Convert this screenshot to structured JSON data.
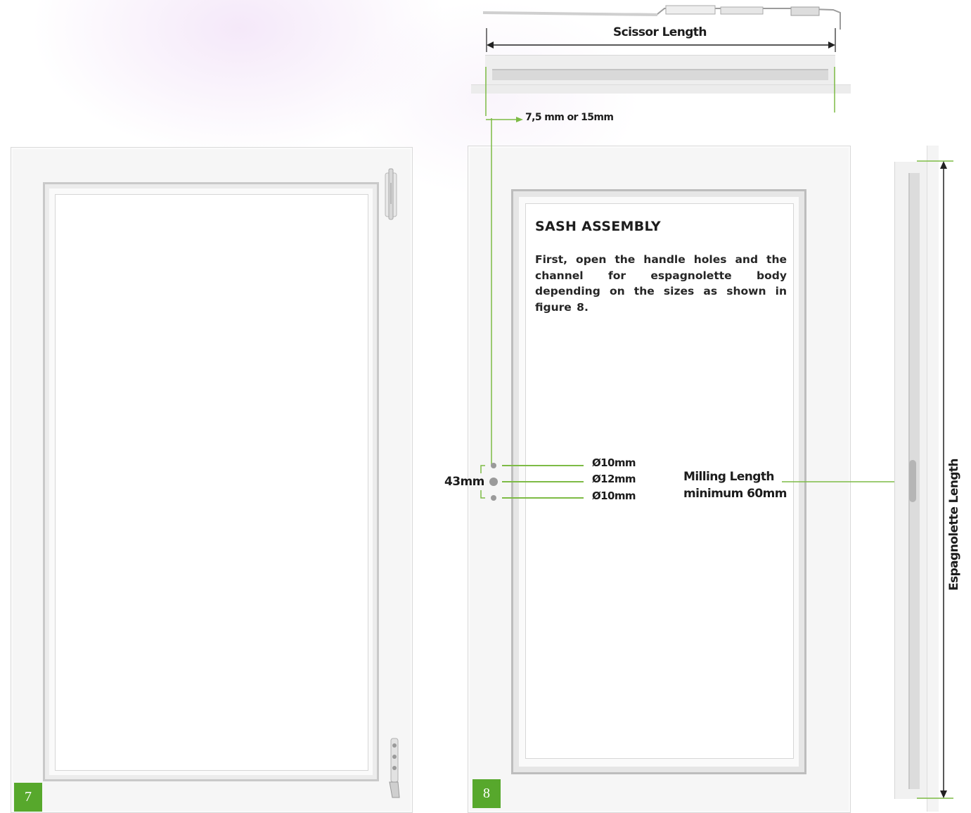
{
  "top_profile": {
    "scissor_label": "Scissor Length",
    "offset_label": "7,5 mm or 15mm"
  },
  "figure_7": {
    "number": "7"
  },
  "figure_8": {
    "number": "8",
    "sash_assembly": {
      "title": "SASH ASSEMBLY",
      "body": "First, open the handle holes and the channel for espagnolette body depending on the sizes as shown in figure 8."
    },
    "handle_holes": {
      "spacing_label": "43mm",
      "holes": [
        "Ø10mm",
        "Ø12mm",
        "Ø10mm"
      ]
    },
    "milling": {
      "label_line1": "Milling Length",
      "label_line2": "minimum 60mm"
    }
  },
  "side_profile": {
    "espagnolette_label": "Espagnolette Length"
  },
  "colors": {
    "accent_green": "#57a82c",
    "leader_green": "#7dbb45",
    "frame_light": "#f6f6f6",
    "bead_grey": "#c9c9c9"
  }
}
